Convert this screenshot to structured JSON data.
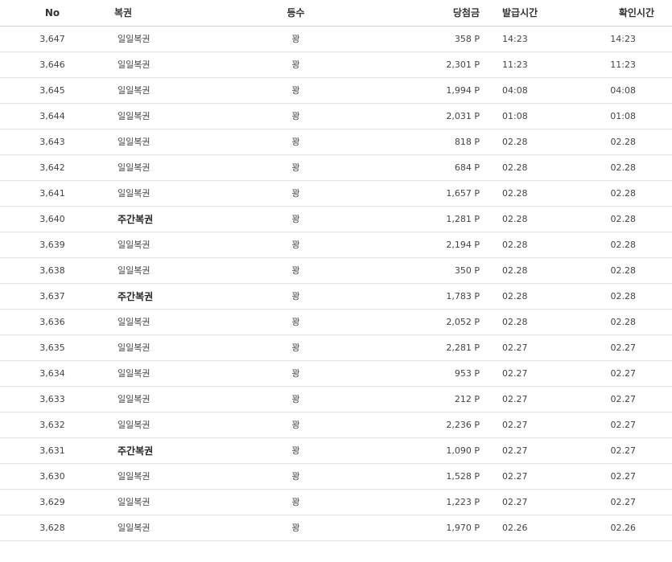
{
  "table": {
    "headers": {
      "no": "No",
      "lottery": "복권",
      "rank": "등수",
      "prize": "당첨금",
      "issued": "발급시간",
      "confirmed": "확인시간"
    },
    "rows": [
      {
        "no": "3,647",
        "lottery": "일일복권",
        "weekly": false,
        "rank": "꽝",
        "prize": "358 P",
        "issued": "14:23",
        "confirmed": "14:23"
      },
      {
        "no": "3,646",
        "lottery": "일일복권",
        "weekly": false,
        "rank": "꽝",
        "prize": "2,301 P",
        "issued": "11:23",
        "confirmed": "11:23"
      },
      {
        "no": "3,645",
        "lottery": "일일복권",
        "weekly": false,
        "rank": "꽝",
        "prize": "1,994 P",
        "issued": "04:08",
        "confirmed": "04:08"
      },
      {
        "no": "3,644",
        "lottery": "일일복권",
        "weekly": false,
        "rank": "꽝",
        "prize": "2,031 P",
        "issued": "01:08",
        "confirmed": "01:08"
      },
      {
        "no": "3,643",
        "lottery": "일일복권",
        "weekly": false,
        "rank": "꽝",
        "prize": "818 P",
        "issued": "02.28",
        "confirmed": "02.28"
      },
      {
        "no": "3,642",
        "lottery": "일일복권",
        "weekly": false,
        "rank": "꽝",
        "prize": "684 P",
        "issued": "02.28",
        "confirmed": "02.28"
      },
      {
        "no": "3,641",
        "lottery": "일일복권",
        "weekly": false,
        "rank": "꽝",
        "prize": "1,657 P",
        "issued": "02.28",
        "confirmed": "02.28"
      },
      {
        "no": "3,640",
        "lottery": "주간복권",
        "weekly": true,
        "rank": "꽝",
        "prize": "1,281 P",
        "issued": "02.28",
        "confirmed": "02.28"
      },
      {
        "no": "3,639",
        "lottery": "일일복권",
        "weekly": false,
        "rank": "꽝",
        "prize": "2,194 P",
        "issued": "02.28",
        "confirmed": "02.28"
      },
      {
        "no": "3,638",
        "lottery": "일일복권",
        "weekly": false,
        "rank": "꽝",
        "prize": "350 P",
        "issued": "02.28",
        "confirmed": "02.28"
      },
      {
        "no": "3,637",
        "lottery": "주간복권",
        "weekly": true,
        "rank": "꽝",
        "prize": "1,783 P",
        "issued": "02.28",
        "confirmed": "02.28"
      },
      {
        "no": "3,636",
        "lottery": "일일복권",
        "weekly": false,
        "rank": "꽝",
        "prize": "2,052 P",
        "issued": "02.28",
        "confirmed": "02.28"
      },
      {
        "no": "3,635",
        "lottery": "일일복권",
        "weekly": false,
        "rank": "꽝",
        "prize": "2,281 P",
        "issued": "02.27",
        "confirmed": "02.27"
      },
      {
        "no": "3,634",
        "lottery": "일일복권",
        "weekly": false,
        "rank": "꽝",
        "prize": "953 P",
        "issued": "02.27",
        "confirmed": "02.27"
      },
      {
        "no": "3,633",
        "lottery": "일일복권",
        "weekly": false,
        "rank": "꽝",
        "prize": "212 P",
        "issued": "02.27",
        "confirmed": "02.27"
      },
      {
        "no": "3,632",
        "lottery": "일일복권",
        "weekly": false,
        "rank": "꽝",
        "prize": "2,236 P",
        "issued": "02.27",
        "confirmed": "02.27"
      },
      {
        "no": "3,631",
        "lottery": "주간복권",
        "weekly": true,
        "rank": "꽝",
        "prize": "1,090 P",
        "issued": "02.27",
        "confirmed": "02.27"
      },
      {
        "no": "3,630",
        "lottery": "일일복권",
        "weekly": false,
        "rank": "꽝",
        "prize": "1,528 P",
        "issued": "02.27",
        "confirmed": "02.27"
      },
      {
        "no": "3,629",
        "lottery": "일일복권",
        "weekly": false,
        "rank": "꽝",
        "prize": "1,223 P",
        "issued": "02.27",
        "confirmed": "02.27"
      },
      {
        "no": "3,628",
        "lottery": "일일복권",
        "weekly": false,
        "rank": "꽝",
        "prize": "1,970 P",
        "issued": "02.26",
        "confirmed": "02.26"
      }
    ]
  }
}
